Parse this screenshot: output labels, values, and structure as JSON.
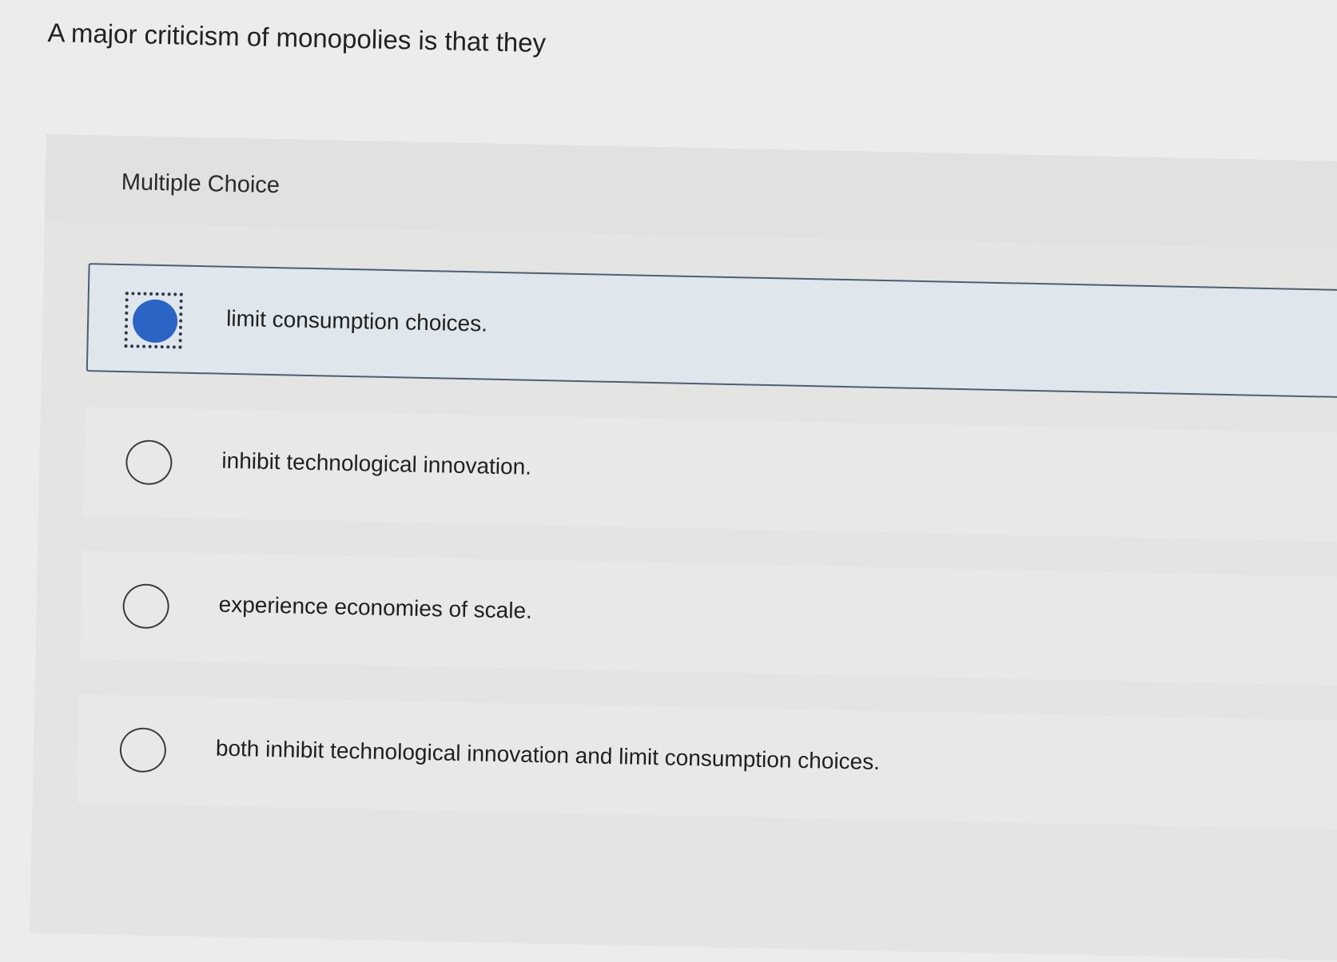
{
  "question": {
    "text": "A major criticism of monopolies is that they"
  },
  "panel": {
    "label": "Multiple Choice"
  },
  "options": [
    {
      "label": "limit consumption choices.",
      "selected": true
    },
    {
      "label": "inhibit technological innovation.",
      "selected": false
    },
    {
      "label": "experience economies of scale.",
      "selected": false
    },
    {
      "label": "both inhibit technological innovation and limit consumption choices.",
      "selected": false
    }
  ],
  "colors": {
    "selected_fill": "#2a64c4",
    "selected_bg": "#dfe6ec",
    "selected_border": "#4b5f74"
  }
}
